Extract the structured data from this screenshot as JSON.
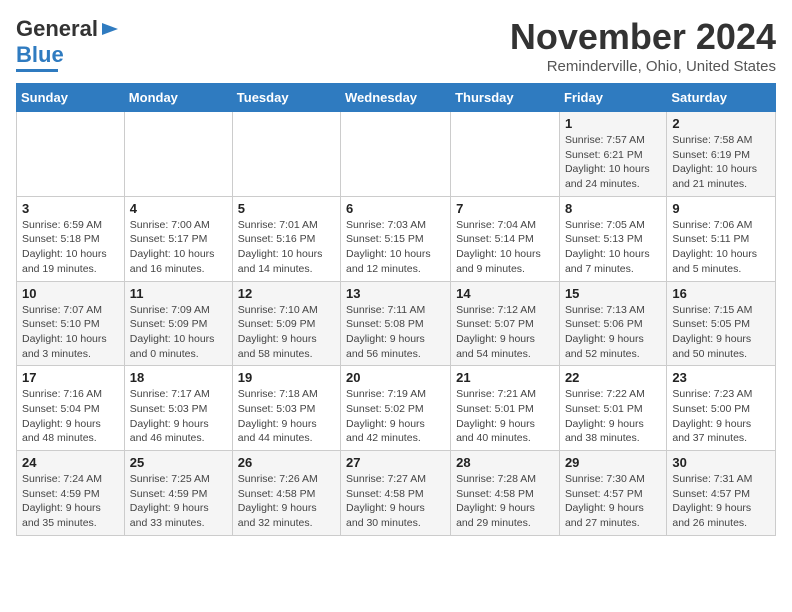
{
  "header": {
    "logo_line1": "General",
    "logo_line2": "Blue",
    "month_title": "November 2024",
    "location": "Reminderville, Ohio, United States"
  },
  "weekdays": [
    "Sunday",
    "Monday",
    "Tuesday",
    "Wednesday",
    "Thursday",
    "Friday",
    "Saturday"
  ],
  "weeks": [
    [
      {
        "day": "",
        "info": ""
      },
      {
        "day": "",
        "info": ""
      },
      {
        "day": "",
        "info": ""
      },
      {
        "day": "",
        "info": ""
      },
      {
        "day": "",
        "info": ""
      },
      {
        "day": "1",
        "info": "Sunrise: 7:57 AM\nSunset: 6:21 PM\nDaylight: 10 hours and 24 minutes."
      },
      {
        "day": "2",
        "info": "Sunrise: 7:58 AM\nSunset: 6:19 PM\nDaylight: 10 hours and 21 minutes."
      }
    ],
    [
      {
        "day": "3",
        "info": "Sunrise: 6:59 AM\nSunset: 5:18 PM\nDaylight: 10 hours and 19 minutes."
      },
      {
        "day": "4",
        "info": "Sunrise: 7:00 AM\nSunset: 5:17 PM\nDaylight: 10 hours and 16 minutes."
      },
      {
        "day": "5",
        "info": "Sunrise: 7:01 AM\nSunset: 5:16 PM\nDaylight: 10 hours and 14 minutes."
      },
      {
        "day": "6",
        "info": "Sunrise: 7:03 AM\nSunset: 5:15 PM\nDaylight: 10 hours and 12 minutes."
      },
      {
        "day": "7",
        "info": "Sunrise: 7:04 AM\nSunset: 5:14 PM\nDaylight: 10 hours and 9 minutes."
      },
      {
        "day": "8",
        "info": "Sunrise: 7:05 AM\nSunset: 5:13 PM\nDaylight: 10 hours and 7 minutes."
      },
      {
        "day": "9",
        "info": "Sunrise: 7:06 AM\nSunset: 5:11 PM\nDaylight: 10 hours and 5 minutes."
      }
    ],
    [
      {
        "day": "10",
        "info": "Sunrise: 7:07 AM\nSunset: 5:10 PM\nDaylight: 10 hours and 3 minutes."
      },
      {
        "day": "11",
        "info": "Sunrise: 7:09 AM\nSunset: 5:09 PM\nDaylight: 10 hours and 0 minutes."
      },
      {
        "day": "12",
        "info": "Sunrise: 7:10 AM\nSunset: 5:09 PM\nDaylight: 9 hours and 58 minutes."
      },
      {
        "day": "13",
        "info": "Sunrise: 7:11 AM\nSunset: 5:08 PM\nDaylight: 9 hours and 56 minutes."
      },
      {
        "day": "14",
        "info": "Sunrise: 7:12 AM\nSunset: 5:07 PM\nDaylight: 9 hours and 54 minutes."
      },
      {
        "day": "15",
        "info": "Sunrise: 7:13 AM\nSunset: 5:06 PM\nDaylight: 9 hours and 52 minutes."
      },
      {
        "day": "16",
        "info": "Sunrise: 7:15 AM\nSunset: 5:05 PM\nDaylight: 9 hours and 50 minutes."
      }
    ],
    [
      {
        "day": "17",
        "info": "Sunrise: 7:16 AM\nSunset: 5:04 PM\nDaylight: 9 hours and 48 minutes."
      },
      {
        "day": "18",
        "info": "Sunrise: 7:17 AM\nSunset: 5:03 PM\nDaylight: 9 hours and 46 minutes."
      },
      {
        "day": "19",
        "info": "Sunrise: 7:18 AM\nSunset: 5:03 PM\nDaylight: 9 hours and 44 minutes."
      },
      {
        "day": "20",
        "info": "Sunrise: 7:19 AM\nSunset: 5:02 PM\nDaylight: 9 hours and 42 minutes."
      },
      {
        "day": "21",
        "info": "Sunrise: 7:21 AM\nSunset: 5:01 PM\nDaylight: 9 hours and 40 minutes."
      },
      {
        "day": "22",
        "info": "Sunrise: 7:22 AM\nSunset: 5:01 PM\nDaylight: 9 hours and 38 minutes."
      },
      {
        "day": "23",
        "info": "Sunrise: 7:23 AM\nSunset: 5:00 PM\nDaylight: 9 hours and 37 minutes."
      }
    ],
    [
      {
        "day": "24",
        "info": "Sunrise: 7:24 AM\nSunset: 4:59 PM\nDaylight: 9 hours and 35 minutes."
      },
      {
        "day": "25",
        "info": "Sunrise: 7:25 AM\nSunset: 4:59 PM\nDaylight: 9 hours and 33 minutes."
      },
      {
        "day": "26",
        "info": "Sunrise: 7:26 AM\nSunset: 4:58 PM\nDaylight: 9 hours and 32 minutes."
      },
      {
        "day": "27",
        "info": "Sunrise: 7:27 AM\nSunset: 4:58 PM\nDaylight: 9 hours and 30 minutes."
      },
      {
        "day": "28",
        "info": "Sunrise: 7:28 AM\nSunset: 4:58 PM\nDaylight: 9 hours and 29 minutes."
      },
      {
        "day": "29",
        "info": "Sunrise: 7:30 AM\nSunset: 4:57 PM\nDaylight: 9 hours and 27 minutes."
      },
      {
        "day": "30",
        "info": "Sunrise: 7:31 AM\nSunset: 4:57 PM\nDaylight: 9 hours and 26 minutes."
      }
    ]
  ]
}
